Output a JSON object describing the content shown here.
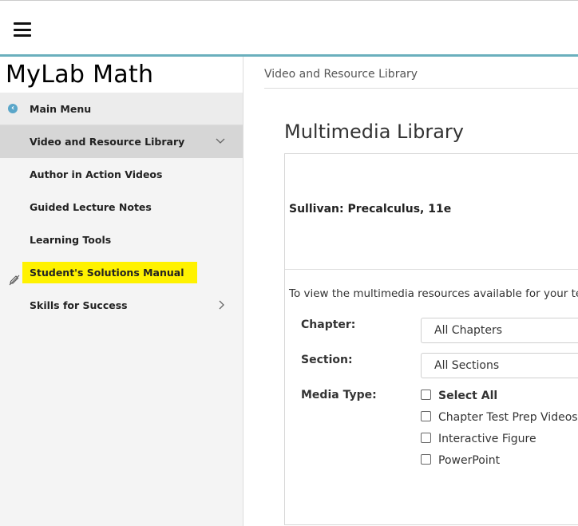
{
  "app": {
    "brand": "MyLab Math"
  },
  "sidebar": {
    "main_menu": "Main Menu",
    "items": [
      {
        "label": "Video and Resource Library"
      },
      {
        "label": "Author in Action Videos"
      },
      {
        "label": "Guided Lecture Notes"
      },
      {
        "label": "Learning Tools"
      },
      {
        "label": "Student's Solutions Manual"
      },
      {
        "label": "Skills for Success"
      }
    ]
  },
  "main": {
    "breadcrumb": "Video and Resource Library",
    "title": "Multimedia Library",
    "book_title": "Sullivan: Precalculus, 11e",
    "intro_text": "To view the multimedia resources available for your text",
    "chapter_label": "Chapter:",
    "chapter_value": "All Chapters",
    "section_label": "Section:",
    "section_value": "All Sections",
    "media_type_label": "Media Type:",
    "media_types": [
      {
        "label": "Select All",
        "checked": false
      },
      {
        "label": "Chapter Test Prep Videos",
        "checked": false
      },
      {
        "label": "Interactive Figure",
        "checked": false
      },
      {
        "label": "PowerPoint",
        "checked": false
      }
    ]
  },
  "colors": {
    "accent_teal": "#6aafbd",
    "highlight": "#fff200",
    "back_icon": "#5aa6c9"
  }
}
